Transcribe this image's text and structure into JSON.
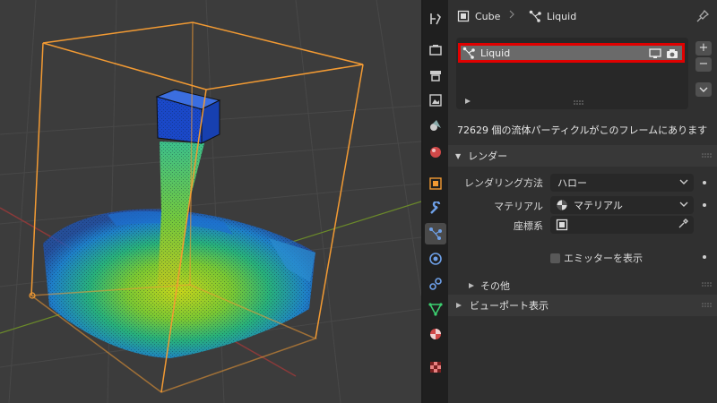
{
  "header": {
    "object_name": "Cube",
    "particle_system_name": "Liquid"
  },
  "particle_list": {
    "selected_item": "Liquid",
    "add_button": "+",
    "remove_button": "−"
  },
  "info_text": "72629 個の流体パーティクルがこのフレームにあります",
  "render_section": {
    "title": "レンダー",
    "render_as_label": "レンダリング方法",
    "render_as_value": "ハロー",
    "material_label": "マテリアル",
    "material_value": "マテリアル",
    "coordinate_label": "座標系",
    "show_emitter_label": "エミッターを表示",
    "extra_subpanel": "その他"
  },
  "viewport_display_section": {
    "title": "ビューポート表示"
  },
  "colors": {
    "highlight_border": "#e00000",
    "selection_outline": "#f29a33",
    "active_tab": "#4a4a4a"
  },
  "icons": [
    "tool-icon",
    "render-icon",
    "output-icon",
    "view-layer-icon",
    "scene-icon",
    "world-icon",
    "object-icon",
    "modifier-icon",
    "particles-icon",
    "physics-icon",
    "constraints-icon",
    "data-icon",
    "material-icon",
    "texture-icon"
  ]
}
